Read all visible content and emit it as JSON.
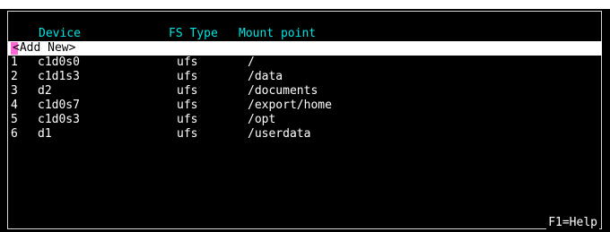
{
  "table": {
    "headers": {
      "device": "Device",
      "fs_type": "FS Type",
      "mount_point": "Mount point"
    },
    "add_new": "<Add New>",
    "rows": [
      {
        "num": "1",
        "device": "c1d0s0",
        "fs_type": "ufs",
        "mount_point": "/"
      },
      {
        "num": "2",
        "device": "c1d1s3",
        "fs_type": "ufs",
        "mount_point": "/data"
      },
      {
        "num": "3",
        "device": "d2",
        "fs_type": "ufs",
        "mount_point": "/documents"
      },
      {
        "num": "4",
        "device": "c1d0s7",
        "fs_type": "ufs",
        "mount_point": "/export/home"
      },
      {
        "num": "5",
        "device": "c1d0s3",
        "fs_type": "ufs",
        "mount_point": "/opt"
      },
      {
        "num": "6",
        "device": "d1",
        "fs_type": "ufs",
        "mount_point": "/userdata"
      }
    ]
  },
  "footer": {
    "help": "F1=Help"
  },
  "colors": {
    "background": "#000000",
    "text": "#ffffff",
    "header": "#00e4e4",
    "selection": "#ffffff",
    "cursor": "#ff4fd0"
  }
}
